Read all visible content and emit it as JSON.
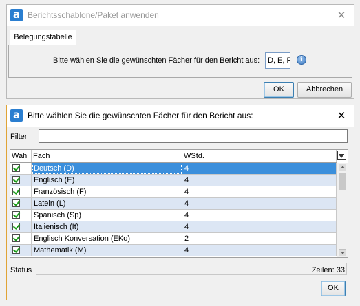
{
  "window1": {
    "title": "Berichtsschablone/Paket anwenden",
    "tab_label": "Belegungstabelle",
    "prompt_label": "Bitte wählen Sie die gewünschten Fächer für den Bericht aus:",
    "selection_value": "D, E, F,",
    "info_glyph": "i",
    "ok_label": "OK",
    "cancel_label": "Abbrechen"
  },
  "window2": {
    "title": "Bitte wählen Sie die gewünschten Fächer für den Bericht aus:",
    "filter_label": "Filter",
    "filter_value": "",
    "columns": {
      "wahl": "Wahl",
      "fach": "Fach",
      "wstd": "WStd."
    },
    "rows": [
      {
        "checked": true,
        "fach": "Deutsch (D)",
        "wstd": "4",
        "selected": true
      },
      {
        "checked": true,
        "fach": "Englisch (E)",
        "wstd": "4"
      },
      {
        "checked": true,
        "fach": "Französisch (F)",
        "wstd": "4"
      },
      {
        "checked": true,
        "fach": "Latein (L)",
        "wstd": "4"
      },
      {
        "checked": true,
        "fach": "Spanisch (Sp)",
        "wstd": "4"
      },
      {
        "checked": true,
        "fach": "Italienisch (It)",
        "wstd": "4"
      },
      {
        "checked": true,
        "fach": "Englisch Konversation (EKo)",
        "wstd": "2"
      },
      {
        "checked": true,
        "fach": "Mathematik (M)",
        "wstd": "4"
      }
    ],
    "status_label": "Status",
    "status_value": "",
    "rows_count_text": "Zeilen: 33",
    "ok_label": "OK"
  },
  "colors": {
    "selection": "#3b8fdc",
    "alt_row": "#dce6f4",
    "active_border": "#e0a436",
    "check_green": "#1a9d1a",
    "app_icon": "#2a7ed0"
  },
  "icons": {
    "app": "app-logo-icon",
    "close": "close-icon",
    "info": "info-icon",
    "column_chooser": "column-chooser-icon",
    "check": "checkbox-checked-icon"
  }
}
